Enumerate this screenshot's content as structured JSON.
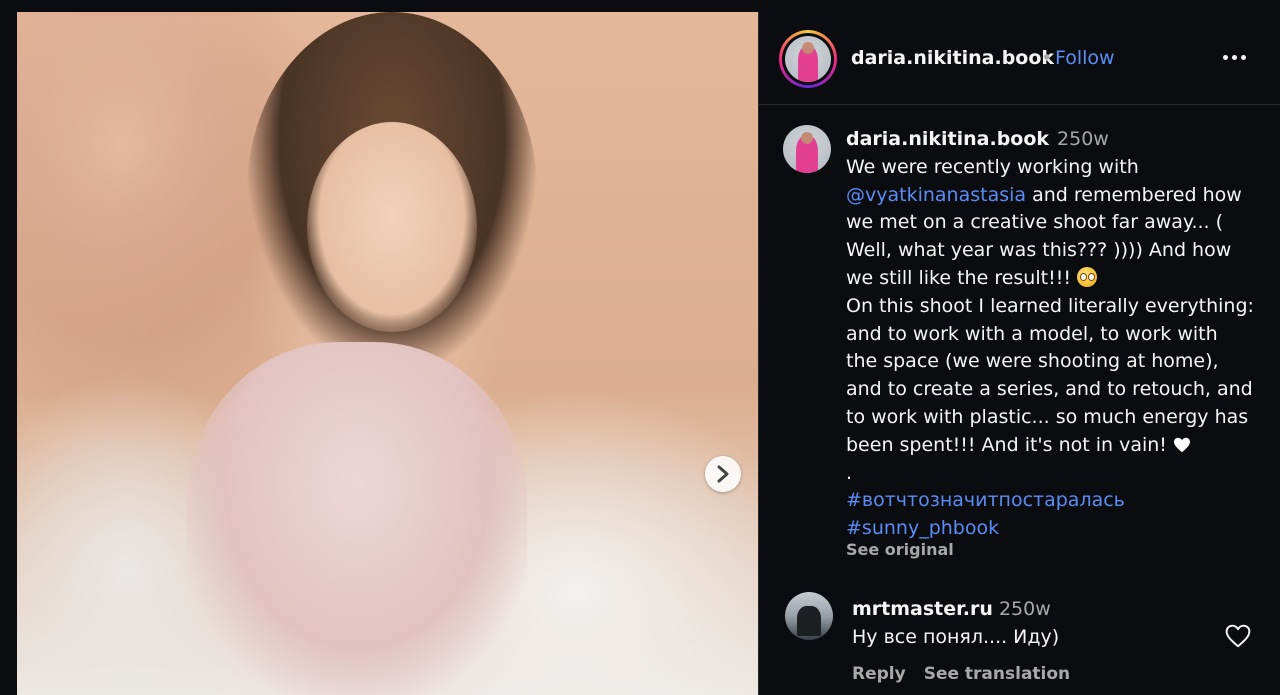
{
  "post": {
    "image_alt": "Photo of a woman in a sheer lace top",
    "next_icon": "chevron-right-icon"
  },
  "header": {
    "username": "daria.nikitina.book",
    "separator": "•",
    "follow_label": "Follow",
    "more_icon": "more-horizontal-icon"
  },
  "caption": {
    "username": "daria.nikitina.book",
    "time": "250w",
    "lines": [
      "We were recently working with",
      "@vyatkinanastasia",
      " and remembered how",
      "we met on a creative shoot far away... (",
      "Well, what year was this??? )))) And how",
      "we still like the result!!! ",
      "On this shoot I learned literally everything:",
      "and to work with a model, to work with",
      "the space (we were shooting at home),",
      "and to create a series, and to retouch, and",
      "to work with plastic... so much energy has",
      "been spent!!! And it's not in vain! ",
      " .",
      " #вотчтозначитпостаралась",
      "#sunny_phbook"
    ],
    "see_original": "See original"
  },
  "comment": {
    "username": "mrtmaster.ru",
    "time": "250w",
    "text": "Ну все понял.... Иду)",
    "reply_label": "Reply",
    "translation_label": "See translation",
    "like_icon": "heart-outline-icon"
  },
  "colors": {
    "link": "#5b8cf5",
    "background": "#0b0c10",
    "secondary_text": "#a8a8a8"
  }
}
